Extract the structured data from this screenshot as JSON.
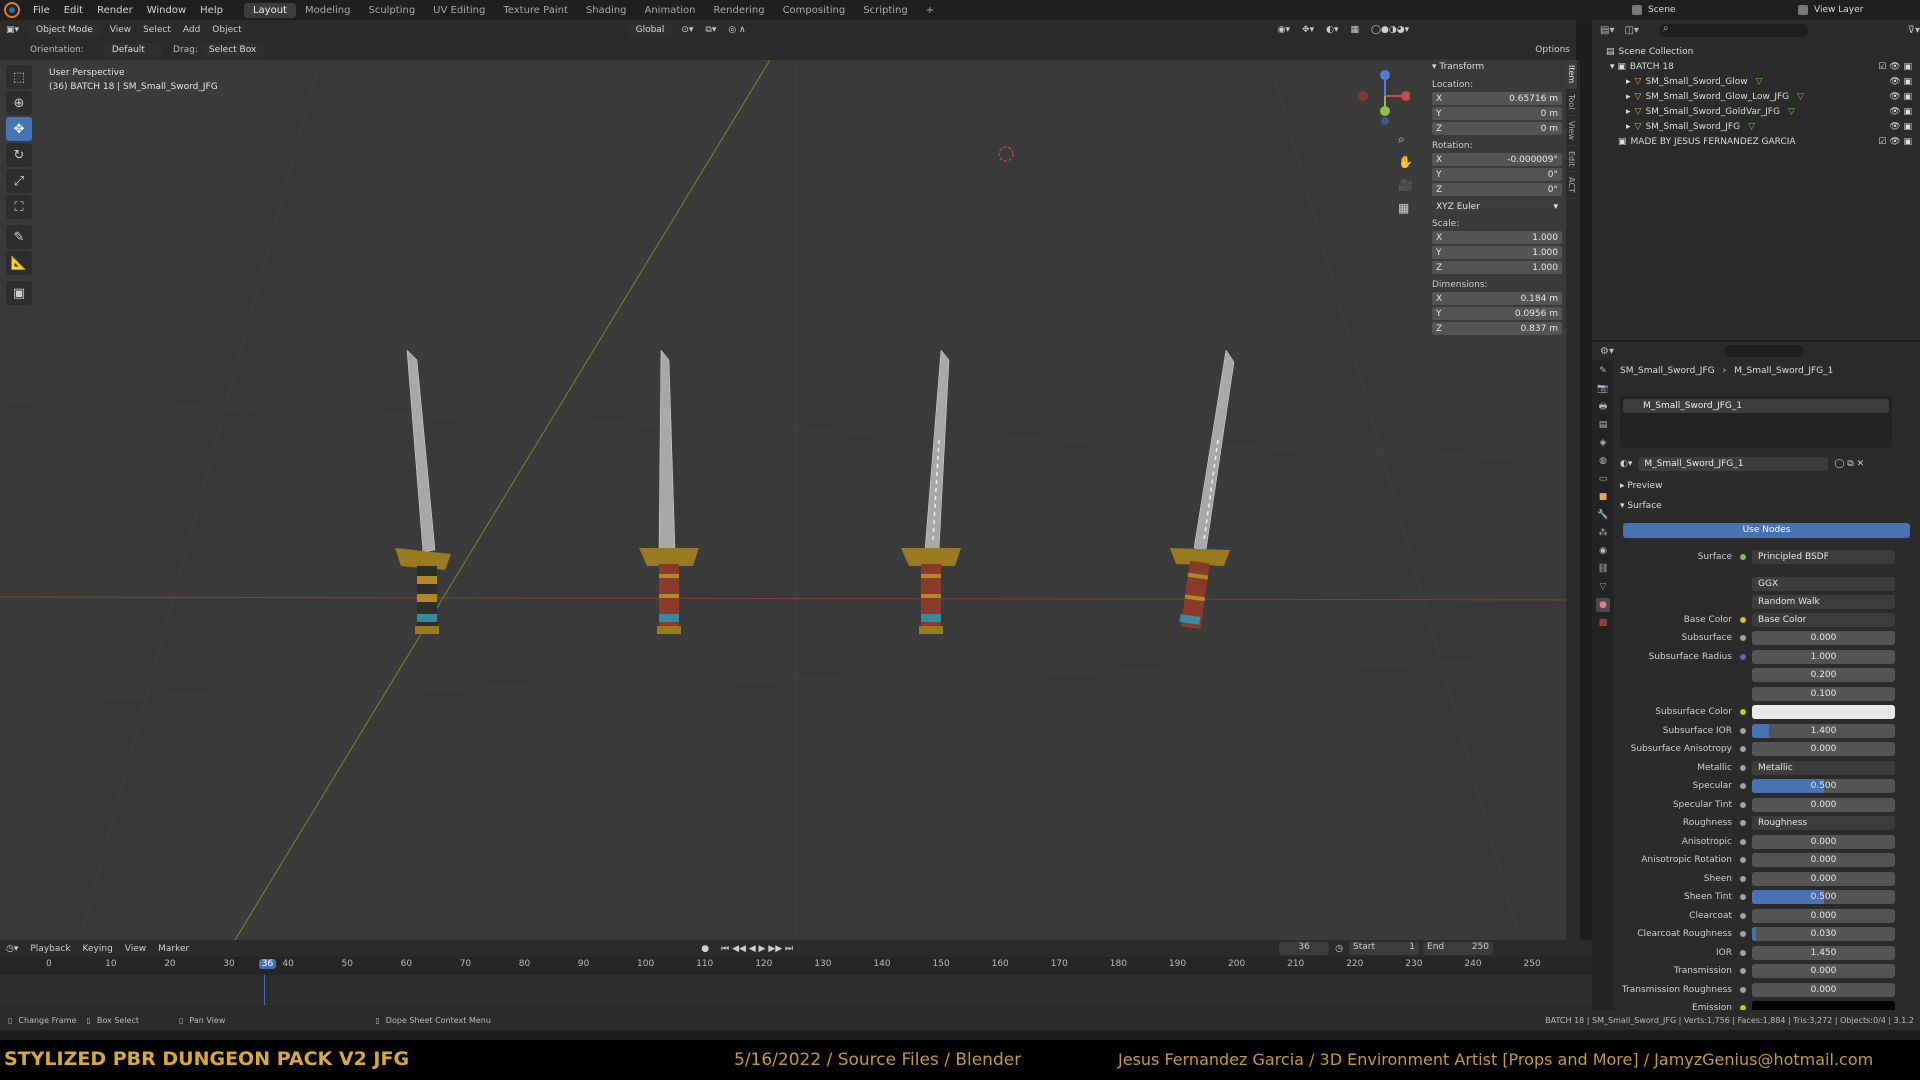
{
  "topbar": {
    "menus": [
      "File",
      "Edit",
      "Render",
      "Window",
      "Help"
    ],
    "workspaces": [
      "Layout",
      "Modeling",
      "Sculpting",
      "UV Editing",
      "Texture Paint",
      "Shading",
      "Animation",
      "Rendering",
      "Compositing",
      "Scripting"
    ],
    "active_workspace": "Layout",
    "add": "+",
    "scene_label": "Scene",
    "view_layer_label": "View Layer"
  },
  "viewport_header": {
    "mode": "Object Mode",
    "menus": [
      "View",
      "Select",
      "Add",
      "Object"
    ],
    "transform_orientation": "Global"
  },
  "tool_settings": {
    "orientation_label": "Orientation:",
    "orientation_value": "Default",
    "drag_label": "Drag:",
    "drag_value": "Select Box",
    "options": "Options"
  },
  "viewport": {
    "perspective": "User Perspective",
    "context": "(36) BATCH 18 | SM_Small_Sword_JFG"
  },
  "npanel": {
    "section": "Transform",
    "location_label": "Location:",
    "location": [
      "0.65716 m",
      "0 m",
      "0 m"
    ],
    "rotation_label": "Rotation:",
    "rotation": [
      "-0.000009°",
      "0°",
      "0°"
    ],
    "rotation_mode": "XYZ Euler",
    "scale_label": "Scale:",
    "scale": [
      "1.000",
      "1.000",
      "1.000"
    ],
    "dimensions_label": "Dimensions:",
    "dimensions": [
      "0.184 m",
      "0.0956 m",
      "0.837 m"
    ],
    "axes": [
      "X",
      "Y",
      "Z"
    ],
    "tabs": [
      "Item",
      "Tool",
      "View",
      "Edit",
      "ACT"
    ]
  },
  "outliner": {
    "root": "Scene Collection",
    "collection": "BATCH 18",
    "items": [
      "SM_Small_Sword_Glow",
      "SM_Small_Sword_Glow_Low_JFG",
      "SM_Small_Sword_GoldVar_JFG",
      "SM_Small_Sword_JFG"
    ],
    "credit": "MADE BY JESUS FERNANDEZ GARCIA"
  },
  "properties": {
    "breadcrumb_object": "SM_Small_Sword_JFG",
    "breadcrumb_material": "M_Small_Sword_JFG_1",
    "slot": "M_Small_Sword_JFG_1",
    "material": "M_Small_Sword_JFG_1",
    "preview": "Preview",
    "surface_section": "Surface",
    "use_nodes": "Use Nodes",
    "surface_label": "Surface",
    "surface_value": "Principled BSDF",
    "distribution": "GGX",
    "subsurface_method": "Random Walk",
    "rows": [
      {
        "label": "Base Color",
        "value": "Base Color",
        "kind": "link",
        "dot": "#c7c729"
      },
      {
        "label": "Subsurface",
        "value": "0.000",
        "kind": "num",
        "dot": "#a1a1a1",
        "fill": 0
      },
      {
        "label": "Subsurface Radius",
        "value": "1.000",
        "kind": "num",
        "dot": "#6363c7",
        "fill": 0
      },
      {
        "label": "",
        "value": "0.200",
        "kind": "num",
        "dot": "",
        "fill": 0
      },
      {
        "label": "",
        "value": "0.100",
        "kind": "num",
        "dot": "",
        "fill": 0
      },
      {
        "label": "Subsurface Color",
        "value": "",
        "kind": "color",
        "dot": "#c7c729",
        "color": "#e8e8e8"
      },
      {
        "label": "Subsurface IOR",
        "value": "1.400",
        "kind": "num",
        "dot": "#a1a1a1",
        "fill": 0.12
      },
      {
        "label": "Subsurface Anisotropy",
        "value": "0.000",
        "kind": "num",
        "dot": "#a1a1a1",
        "fill": 0
      },
      {
        "label": "Metallic",
        "value": "Metallic",
        "kind": "link",
        "dot": "#a1a1a1"
      },
      {
        "label": "Specular",
        "value": "0.500",
        "kind": "num",
        "dot": "#a1a1a1",
        "fill": 0.5
      },
      {
        "label": "Specular Tint",
        "value": "0.000",
        "kind": "num",
        "dot": "#a1a1a1",
        "fill": 0
      },
      {
        "label": "Roughness",
        "value": "Roughness",
        "kind": "link",
        "dot": "#a1a1a1"
      },
      {
        "label": "Anisotropic",
        "value": "0.000",
        "kind": "num",
        "dot": "#a1a1a1",
        "fill": 0
      },
      {
        "label": "Anisotropic Rotation",
        "value": "0.000",
        "kind": "num",
        "dot": "#a1a1a1",
        "fill": 0
      },
      {
        "label": "Sheen",
        "value": "0.000",
        "kind": "num",
        "dot": "#a1a1a1",
        "fill": 0
      },
      {
        "label": "Sheen Tint",
        "value": "0.500",
        "kind": "num",
        "dot": "#a1a1a1",
        "fill": 0.5
      },
      {
        "label": "Clearcoat",
        "value": "0.000",
        "kind": "num",
        "dot": "#a1a1a1",
        "fill": 0
      },
      {
        "label": "Clearcoat Roughness",
        "value": "0.030",
        "kind": "num",
        "dot": "#a1a1a1",
        "fill": 0.03
      },
      {
        "label": "IOR",
        "value": "1.450",
        "kind": "num",
        "dot": "#a1a1a1",
        "fill": 0
      },
      {
        "label": "Transmission",
        "value": "0.000",
        "kind": "num",
        "dot": "#a1a1a1",
        "fill": 0
      },
      {
        "label": "Transmission Roughness",
        "value": "0.000",
        "kind": "num",
        "dot": "#a1a1a1",
        "fill": 0
      },
      {
        "label": "Emission",
        "value": "",
        "kind": "color",
        "dot": "#c7c729",
        "color": "#000000"
      }
    ]
  },
  "timeline": {
    "menus": [
      "Playback",
      "Keying",
      "View",
      "Marker"
    ],
    "current_frame": "36",
    "start_label": "Start",
    "start": "1",
    "end_label": "End",
    "end": "250",
    "ticks": [
      "0",
      "10",
      "20",
      "30",
      "36",
      "40",
      "50",
      "60",
      "70",
      "80",
      "90",
      "100",
      "110",
      "120",
      "130",
      "140",
      "150",
      "160",
      "170",
      "180",
      "190",
      "200",
      "210",
      "220",
      "230",
      "240",
      "250"
    ]
  },
  "statusbar": {
    "items": [
      "Change Frame",
      "Box Select",
      "Pan View",
      "Dope Sheet Context Menu"
    ],
    "stats": "BATCH 18 | SM_Small_Sword_JFG | Verts:1,756 | Faces:1,884 | Tris:3,272 | Objects:0/4 | 3.1.2"
  },
  "banner": {
    "left": "STYLIZED PBR DUNGEON PACK V2 JFG",
    "middle": "5/16/2022 / Source Files / Blender",
    "right": "Jesus Fernandez Garcia / 3D Environment Artist [Props and More] / JamyzGenius@hotmail.com"
  },
  "colors": {
    "accent": "#4772b3",
    "banner_text": "#d9a93a",
    "axis_x": "#c84b4b",
    "axis_y": "#8fbf3f",
    "axis_z": "#4f7fd6"
  }
}
